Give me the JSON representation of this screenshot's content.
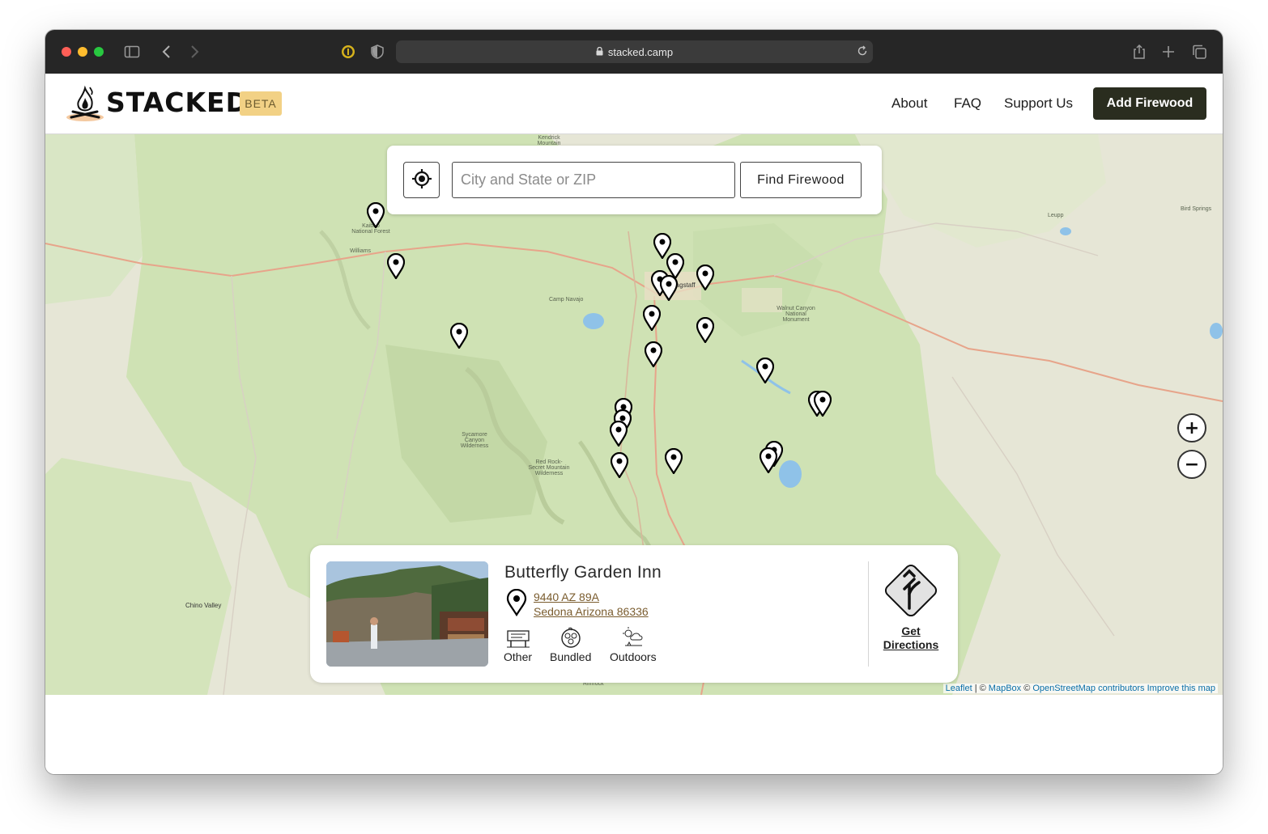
{
  "browser": {
    "url": "stacked.camp",
    "colors": {
      "close": "#ff5f57",
      "minimize": "#febc2e",
      "maximize": "#28c840"
    }
  },
  "header": {
    "logo_text": "STACKED",
    "badge": "BETA",
    "nav": [
      {
        "label": "About"
      },
      {
        "label": "FAQ"
      },
      {
        "label": "Support Us"
      }
    ],
    "cta_label": "Add Firewood",
    "colors": {
      "cta_bg": "#2a2d1f",
      "badge_bg": "#f2d185"
    }
  },
  "search": {
    "placeholder": "City and State or ZIP",
    "value": "",
    "button_label": "Find Firewood"
  },
  "map": {
    "labels": [
      "Williams",
      "Camp Navajo",
      "Flagstaff",
      "Walnut Canyon National Monument",
      "Sycamore Canyon Wilderness",
      "Red Rock-Secret Mountain Wilderness",
      "Chino Valley",
      "Leupp",
      "Bird Springs",
      "Kaibab National Forest",
      "Kendrick Mountain Wilderness",
      "Rimrock"
    ],
    "zoom_in": "+",
    "zoom_out": "−",
    "attribution": {
      "leaflet": "Leaflet",
      "mid": " | © ",
      "mapbox": "MapBox",
      "sep": " © ",
      "osm": "OpenStreetMap contributors",
      "improve": "Improve this map"
    }
  },
  "card": {
    "title": "Butterfly Garden Inn",
    "address_line1": "9440 AZ 89A",
    "address_line2": "Sedona Arizona 86336",
    "tags": [
      {
        "label": "Other",
        "icon": "sign-icon"
      },
      {
        "label": "Bundled",
        "icon": "bundle-icon"
      },
      {
        "label": "Outdoors",
        "icon": "outdoors-icon"
      }
    ],
    "directions_line1": "Get",
    "directions_line2": "Directions"
  }
}
